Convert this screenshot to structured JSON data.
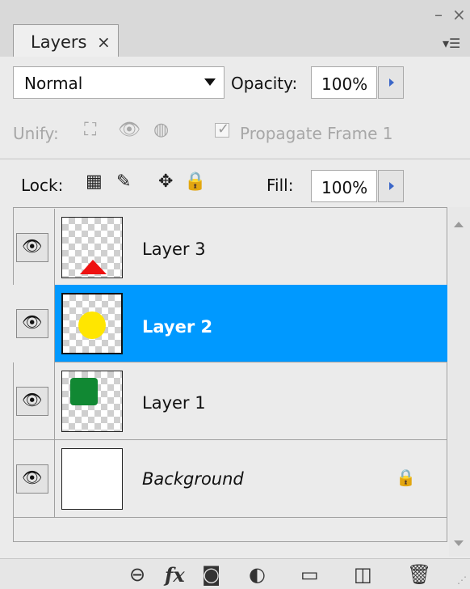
{
  "panel": {
    "tab_label": "Layers",
    "tab_close": "×",
    "win_min": "–",
    "win_close": "×",
    "menu_glyph": "▾☰"
  },
  "controls": {
    "blend_mode": "Normal",
    "opacity_label": "Opacity:",
    "opacity_value": "100%",
    "unify_label": "Unify:",
    "propagate_label": "Propagate Frame 1",
    "propagate_checked": true,
    "lock_label": "Lock:",
    "fill_label": "Fill:",
    "fill_value": "100%"
  },
  "icons": {
    "unify_position": "⛶",
    "unify_visibility": "👁",
    "unify_style": "◍",
    "lock_transparent": "▦",
    "lock_image": "✎",
    "lock_position": "✥",
    "lock_all": "🔒",
    "eye": "👁",
    "link": "⊖",
    "fx": "fx",
    "mask": "◙",
    "adjustment": "◐",
    "group": "▭",
    "new_layer": "◫",
    "trash": "🗑"
  },
  "layers": [
    {
      "name": "Layer 3",
      "visible": true,
      "selected": false,
      "content": "red-triangle",
      "color": "#ee1111"
    },
    {
      "name": "Layer 2",
      "visible": true,
      "selected": true,
      "content": "yellow-circle",
      "color": "#ffe600"
    },
    {
      "name": "Layer 1",
      "visible": true,
      "selected": false,
      "content": "green-square",
      "color": "#118833"
    },
    {
      "name": "Background",
      "visible": true,
      "selected": false,
      "content": "white",
      "locked": true,
      "italic": true
    }
  ],
  "colors": {
    "selection": "#0099ff",
    "stepper_arrow": "#3a66c8"
  }
}
